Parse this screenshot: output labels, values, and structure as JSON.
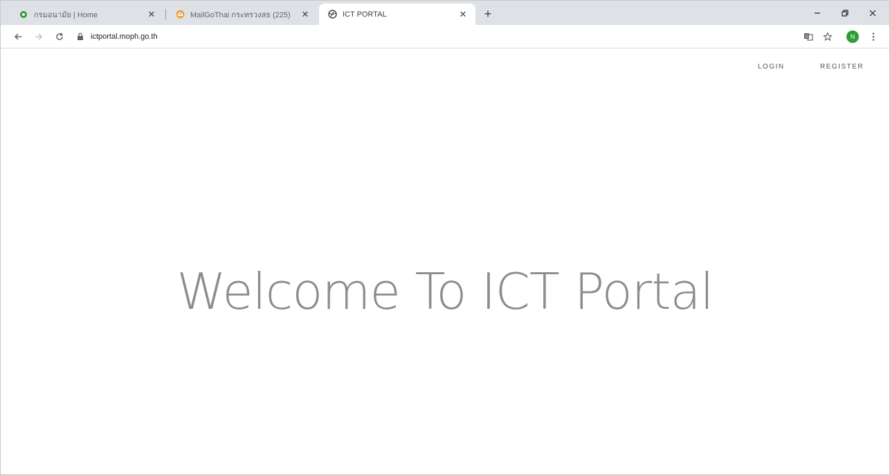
{
  "browser": {
    "tabs": [
      {
        "title": "กรมอนามัย | Home",
        "favicon": "green-circle-icon",
        "active": false
      },
      {
        "title": "MailGoThai กระทรวงสธ (225)",
        "favicon": "mail-icon",
        "active": false
      },
      {
        "title": "ICT PORTAL",
        "favicon": "globe-icon",
        "active": true
      }
    ],
    "new_tab": "+",
    "address": "ictportal.moph.go.th",
    "profile_initial": "N",
    "accent_color": "#2e9d34"
  },
  "nav": {
    "login": "LOGIN",
    "register": "REGISTER"
  },
  "hero": {
    "heading": "Welcome To ICT Portal"
  }
}
